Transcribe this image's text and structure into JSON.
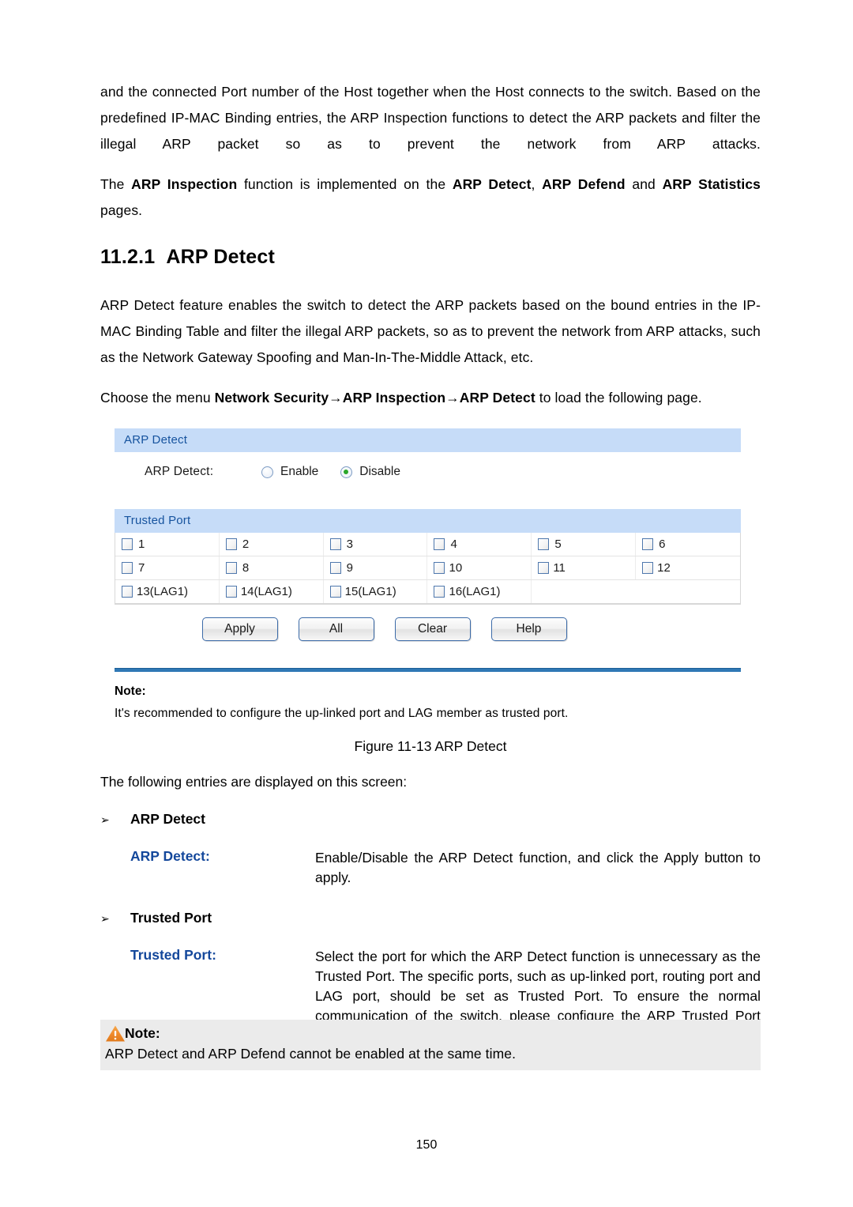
{
  "document": {
    "page_number": "150"
  },
  "paragraphs": {
    "intro_1": "and the connected Port number of the Host together when the Host connects to the switch. Based on the predefined IP-MAC Binding entries, the ARP Inspection functions to detect the ARP packets and filter the illegal ARP packet so as to prevent the network from ARP attacks.",
    "intro_2_pre": "The ",
    "intro_2_b1": "ARP Inspection",
    "intro_2_mid": " function is implemented on the ",
    "intro_2_b2": "ARP Detect",
    "intro_2_comma": ", ",
    "intro_2_b3": "ARP Defend",
    "intro_2_and": " and ",
    "intro_2_b4": "ARP Statistics",
    "intro_2_post": " pages.",
    "feature_desc": "ARP Detect feature enables the switch to detect the ARP packets based on the bound entries in the IP-MAC Binding Table and filter the illegal ARP packets, so as to prevent the network from ARP attacks, such as the Network Gateway Spoofing and Man-In-The-Middle Attack, etc.",
    "choose_pre": "Choose the menu ",
    "choose_path": "Network Security→ARP Inspection→ARP Detect",
    "choose_post": " to load the following page.",
    "lead_line": "The following entries are displayed on this screen:"
  },
  "heading": {
    "number": "11.2.1",
    "title": "ARP Detect"
  },
  "ui": {
    "arp_detect_panel": {
      "bar_title": "ARP Detect",
      "field_label": "ARP Detect:",
      "options": [
        {
          "label": "Enable",
          "selected": false
        },
        {
          "label": "Disable",
          "selected": true
        }
      ]
    },
    "trusted_port_panel": {
      "bar_title": "Trusted Port",
      "rows": [
        [
          {
            "label": "1",
            "checked": false
          },
          {
            "label": "2",
            "checked": false
          },
          {
            "label": "3",
            "checked": false
          },
          {
            "label": "4",
            "checked": false
          },
          {
            "label": "5",
            "checked": false
          },
          {
            "label": "6",
            "checked": false
          }
        ],
        [
          {
            "label": "7",
            "checked": false
          },
          {
            "label": "8",
            "checked": false
          },
          {
            "label": "9",
            "checked": false
          },
          {
            "label": "10",
            "checked": false
          },
          {
            "label": "11",
            "checked": false
          },
          {
            "label": "12",
            "checked": false
          }
        ],
        [
          {
            "label": "13(LAG1)",
            "checked": false
          },
          {
            "label": "14(LAG1)",
            "checked": false
          },
          {
            "label": "15(LAG1)",
            "checked": false
          },
          {
            "label": "16(LAG1)",
            "checked": false
          }
        ]
      ]
    },
    "buttons": [
      {
        "label": "Apply"
      },
      {
        "label": "All"
      },
      {
        "label": "Clear"
      },
      {
        "label": "Help"
      }
    ],
    "note": {
      "title": "Note:",
      "text": "It's recommended to configure the up-linked port and LAG member as trusted port."
    }
  },
  "figure": {
    "caption": "Figure 11-13 ARP Detect"
  },
  "entries": {
    "group_1": {
      "bullet": "➢",
      "heading": "ARP Detect",
      "term": "ARP Detect:",
      "description": "Enable/Disable the ARP Detect function, and click the Apply button to apply."
    },
    "group_2": {
      "bullet": "➢",
      "heading": "Trusted Port",
      "term": "Trusted Port:",
      "description": "Select the port for which the ARP Detect function is unnecessary as the Trusted Port. The specific ports, such as up-linked port, routing port and LAG port, should be set as Trusted Port. To ensure the normal communication of the switch, please configure the ARP Trusted Port before enabling the ARP Detect function."
    }
  },
  "bottom_note": {
    "icon": "warning-triangle-icon",
    "title": "Note:",
    "text": "ARP Detect and ARP Defend cannot be enabled at the same time."
  },
  "colors": {
    "panel_bar_bg": "#c6dcf8",
    "panel_bar_text": "#16539e",
    "term_blue": "#13479b",
    "divider_blue": "#2f78b5",
    "note_box_bg": "#ebebeb",
    "warning_orange": "#ef8a2b",
    "radio_selected_green": "#2aa72a"
  }
}
